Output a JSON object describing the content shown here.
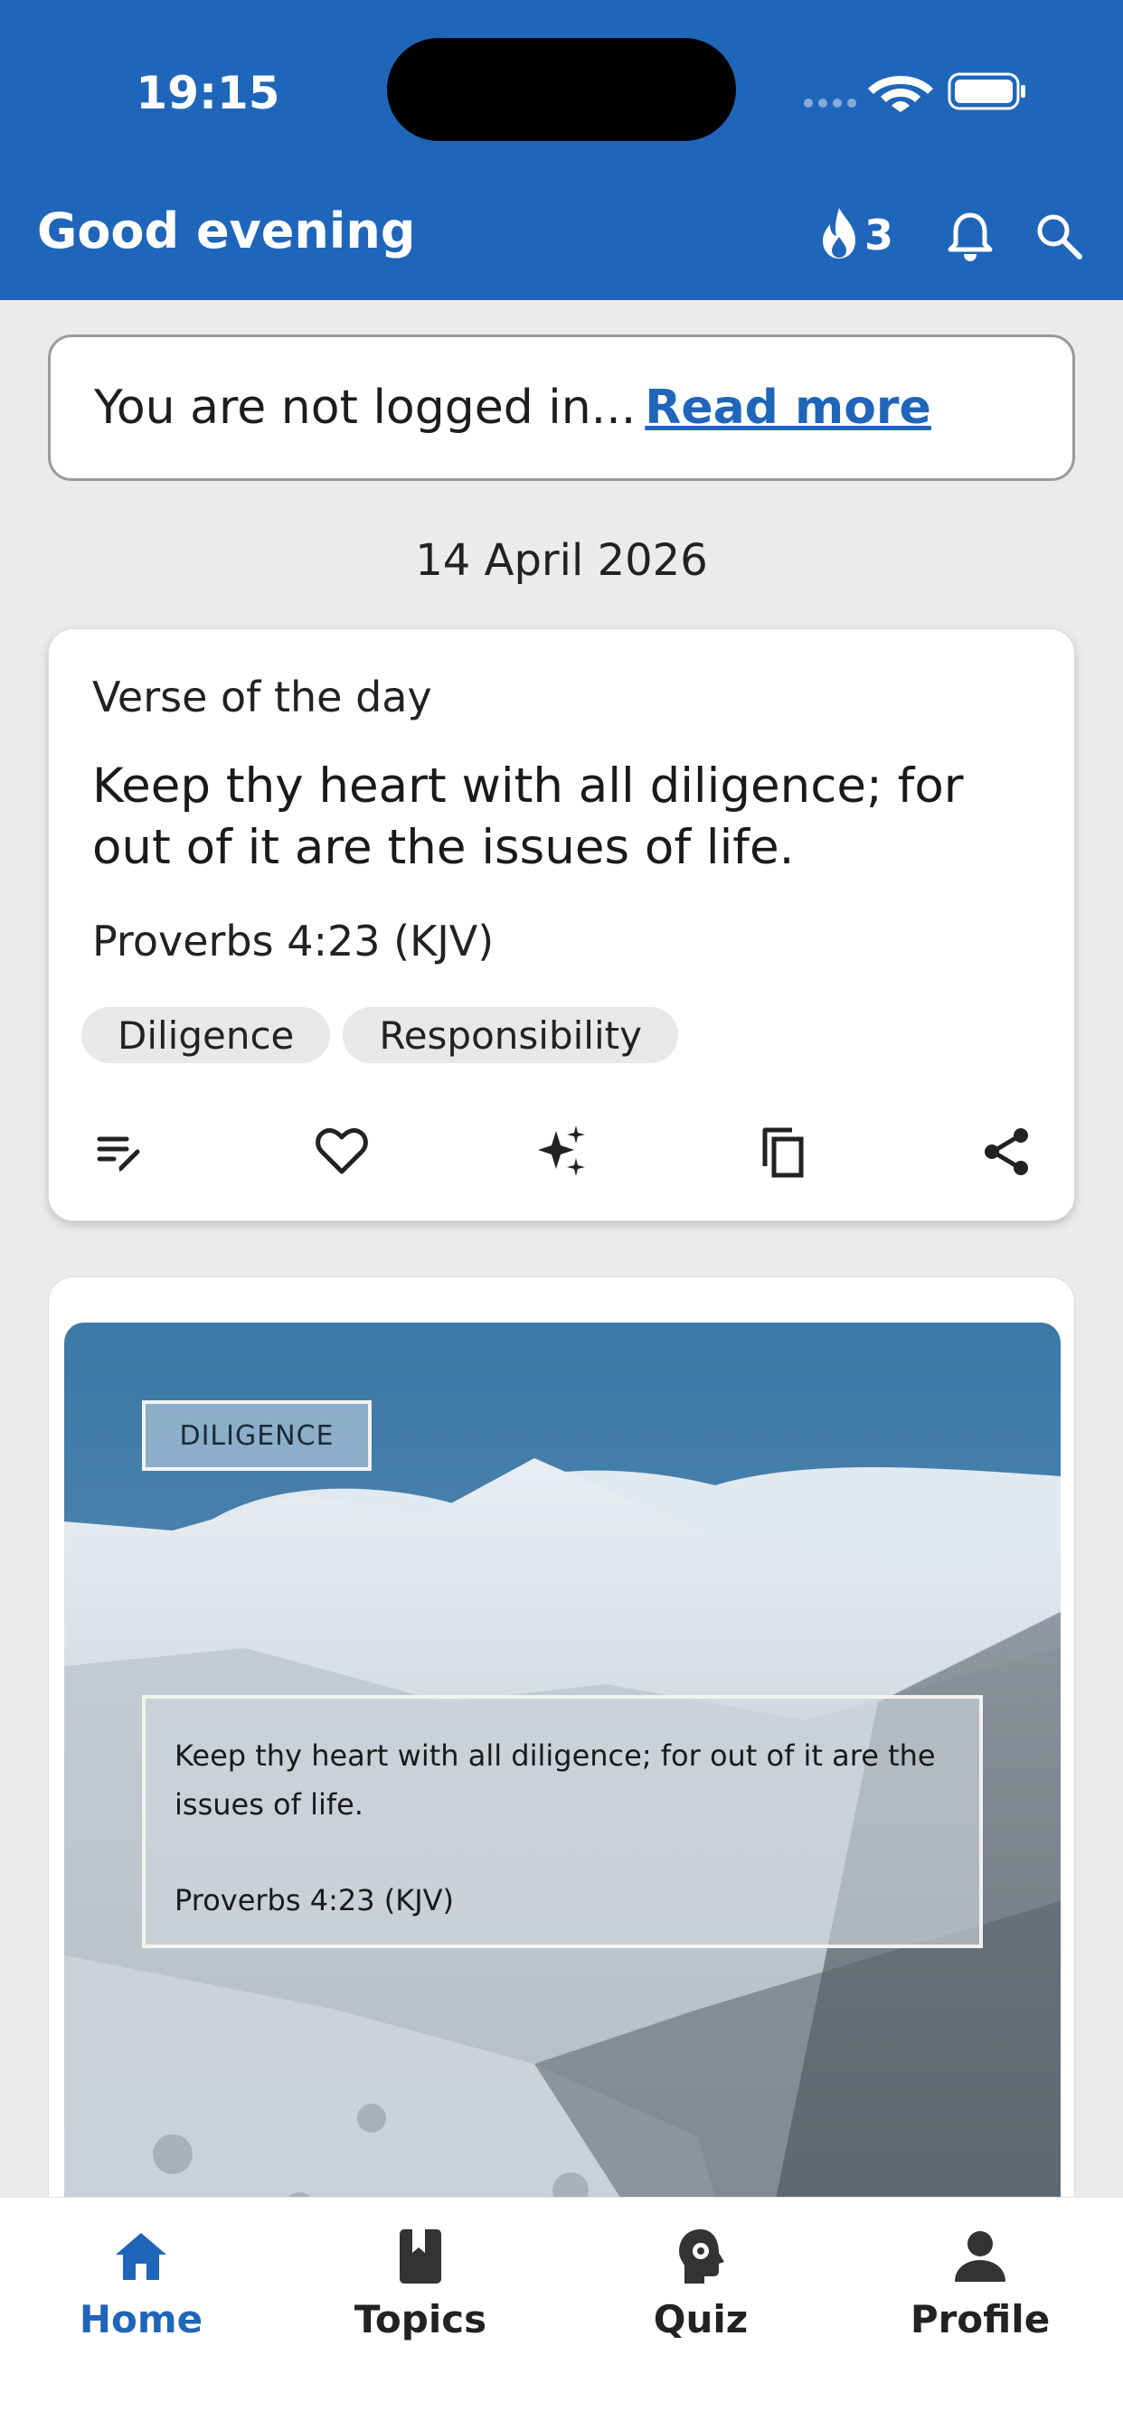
{
  "status_bar": {
    "time": "19:15"
  },
  "header": {
    "greeting": "Good evening",
    "streak_count": "3"
  },
  "login_banner": {
    "message": "You are not logged in...",
    "link_label": "Read more"
  },
  "date": "14 April 2026",
  "verse_card": {
    "title": "Verse of the day",
    "text": "Keep thy heart with all diligence; for out of it are the issues of life.",
    "reference": "Proverbs 4:23 (KJV)",
    "tags": [
      "Diligence",
      "Responsibility"
    ],
    "actions": [
      "edit-note-icon",
      "heart-icon",
      "sparkle-icon",
      "copy-icon",
      "share-icon"
    ]
  },
  "image_card": {
    "topic": "DILIGENCE",
    "quote": "Keep thy heart with all diligence; for out of it are the issues of life.",
    "reference": "Proverbs 4:23 (KJV)"
  },
  "tabs": [
    {
      "label": "Home",
      "icon": "home-icon",
      "active": true
    },
    {
      "label": "Topics",
      "icon": "book-icon",
      "active": false
    },
    {
      "label": "Quiz",
      "icon": "quiz-head-icon",
      "active": false
    },
    {
      "label": "Profile",
      "icon": "person-icon",
      "active": false
    }
  ],
  "colors": {
    "primary": "#1f66ba",
    "background": "#ebebeb"
  }
}
